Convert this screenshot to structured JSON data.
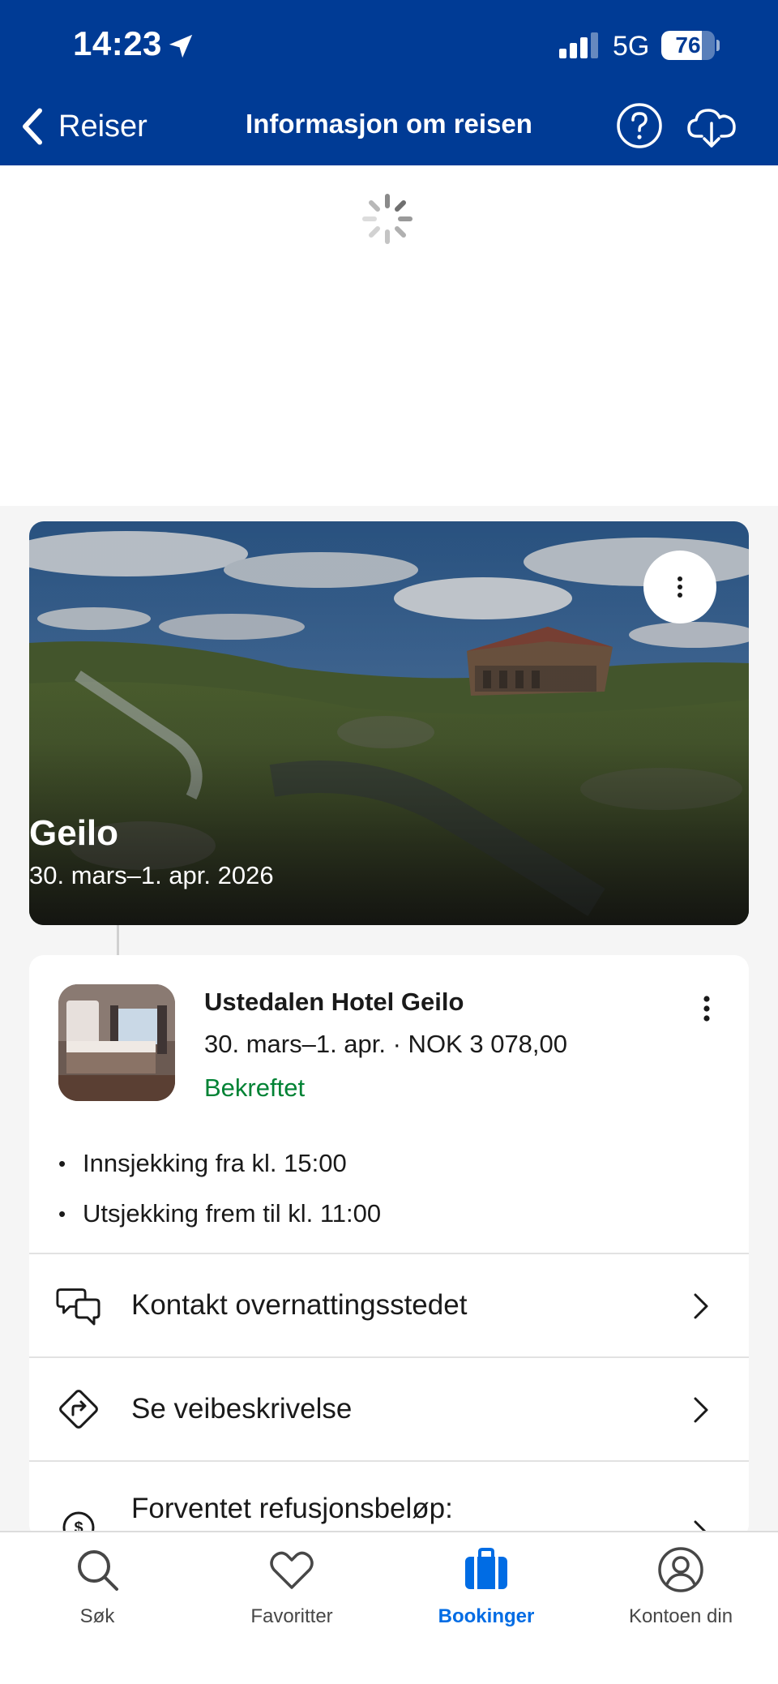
{
  "status_bar": {
    "time": "14:23",
    "network": "5G",
    "battery_level": "76",
    "battery_fraction": 0.76
  },
  "nav": {
    "back_label": "Reiser",
    "title": "Informasjon om reisen",
    "help_icon": "help-circle-icon",
    "download_icon": "cloud-download-icon"
  },
  "loading_icon": "spinner-icon",
  "trip": {
    "destination": "Geilo",
    "dates": "30. mars–1. apr. 2026",
    "image": "mountain-cabin-landscape"
  },
  "booking": {
    "hotel_name": "Ustedalen Hotel Geilo",
    "meta": "30. mars–1. apr. · NOK 3 078,00",
    "status": "Bekreftet",
    "details": [
      "Innsjekking fra kl. 15:00",
      "Utsjekking frem til kl. 11:00"
    ],
    "actions": [
      {
        "label": "Kontakt overnattingsstedet",
        "icon": "chat-bubbles-icon"
      },
      {
        "label": "Se veibeskrivelse",
        "icon": "directions-icon"
      },
      {
        "label": "Forventet refusjonsbeløp:",
        "icon": "refund-icon"
      }
    ]
  },
  "tabs": [
    {
      "label": "Søk",
      "icon": "search-icon",
      "active": false
    },
    {
      "label": "Favoritter",
      "icon": "heart-icon",
      "active": false
    },
    {
      "label": "Bookinger",
      "icon": "suitcase-icon",
      "active": true
    },
    {
      "label": "Kontoen din",
      "icon": "account-icon",
      "active": false
    }
  ],
  "colors": {
    "brand": "#003b95",
    "accent": "#006ce4",
    "confirmed": "#008234"
  }
}
